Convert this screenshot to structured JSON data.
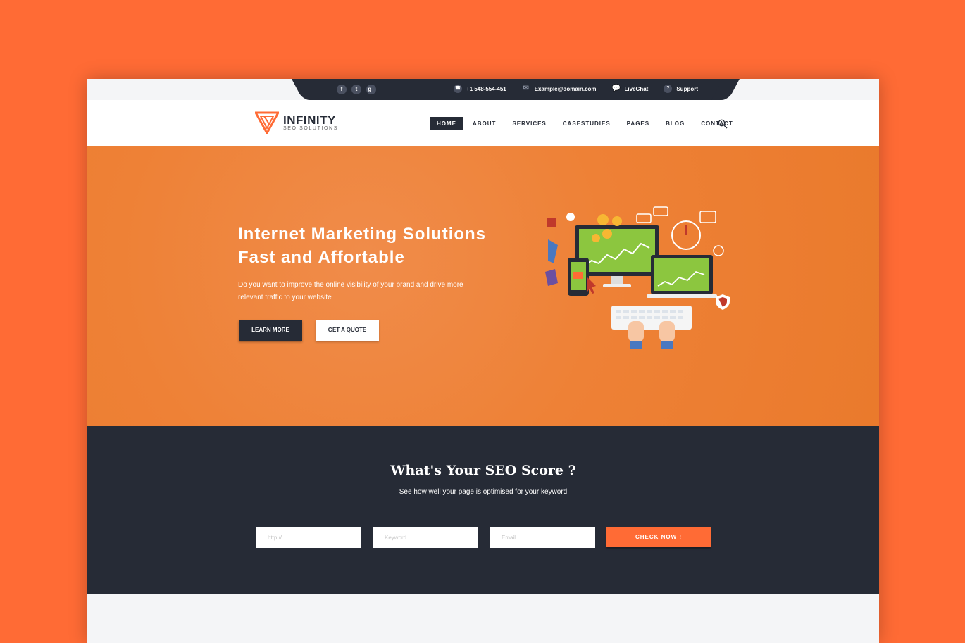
{
  "topbar": {
    "social": [
      {
        "icon": "facebook-icon",
        "glyph": "f"
      },
      {
        "icon": "twitter-icon",
        "glyph": "t"
      },
      {
        "icon": "google-plus-icon",
        "glyph": "g+"
      }
    ],
    "phone": "+1 548-554-451",
    "email": "Example@domain.com",
    "livechat": "LiveChat",
    "support": "Support"
  },
  "header": {
    "logo_title": "INFINITY",
    "logo_subtitle": "SEO SOLUTIONS",
    "nav": [
      "HOME",
      "ABOUT",
      "SERVICES",
      "CASESTUDIES",
      "PAGES",
      "BLOG",
      "CONTACT"
    ],
    "active_nav": "HOME"
  },
  "hero": {
    "title_line1": "Internet Marketing Solutions",
    "title_line2": "Fast and Affortable",
    "description": "Do you want to improve the online visibility of your brand and drive more relevant traffic to your website",
    "primary_button": "LEARN MORE",
    "secondary_button": "GET A QUOTE"
  },
  "seo": {
    "title": "What's Your SEO Score ?",
    "subtitle": "See how well your page is optimised for your keyword",
    "url_placeholder": "http://",
    "keyword_placeholder": "Keyword",
    "email_placeholder": "Email",
    "button": "CHECK NOW !"
  },
  "colors": {
    "accent": "#ff6b35",
    "dark": "#262b36",
    "hero_orange": "#ee8136",
    "screen_green": "#8cc63f"
  }
}
